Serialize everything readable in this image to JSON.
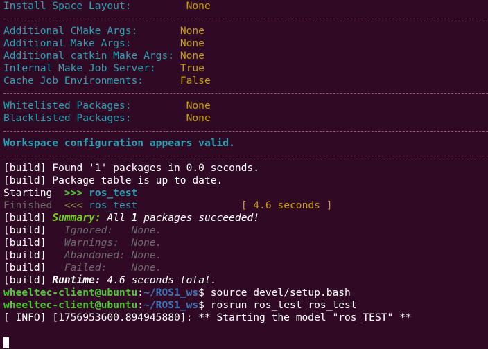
{
  "config": {
    "install_space_layout": {
      "key": "Install Space Layout:",
      "value": "None"
    },
    "additional_cmake_args": {
      "key": "Additional CMake Args:",
      "value": "None"
    },
    "additional_make_args": {
      "key": "Additional Make Args:",
      "value": "None"
    },
    "additional_catkin_make_args": {
      "key": "Additional catkin Make Args:",
      "value": "None"
    },
    "internal_make_job_server": {
      "key": "Internal Make Job Server:",
      "value": "True"
    },
    "cache_job_environments": {
      "key": "Cache Job Environments:",
      "value": "False"
    },
    "whitelisted_packages": {
      "key": "Whitelisted Packages:",
      "value": "None"
    },
    "blacklisted_packages": {
      "key": "Blacklisted Packages:",
      "value": "None"
    },
    "valid_message": "Workspace configuration appears valid."
  },
  "build": {
    "prefix": "[build]",
    "found": " Found '1' packages in 0.0 seconds.",
    "table": " Package table is up to date.",
    "starting_label": "Starting",
    "starting_arrow": ">>>",
    "starting_pkg": "ros_test",
    "finished_label": "Finished",
    "finished_arrow": "<<<",
    "finished_pkg": "ros_test",
    "finished_time": "[ 4.6 seconds ]",
    "summary_label": "Summary:",
    "summary_pre": " All ",
    "summary_count": "1",
    "summary_post": " packages succeeded!",
    "ignored_label": "Ignored:",
    "ignored_value": "None.",
    "warnings_label": "Warnings:",
    "warnings_value": "None.",
    "abandoned_label": "Abandoned:",
    "abandoned_value": "None.",
    "failed_label": "Failed:",
    "failed_value": "None.",
    "runtime_label": "Runtime:",
    "runtime_value": " 4.6 seconds total."
  },
  "prompts": [
    {
      "user": "wheeltec-client@ubuntu",
      "sep": ":",
      "path": "~/ROS1_ws",
      "symbol": "$",
      "command": " source devel/setup.bash"
    },
    {
      "user": "wheeltec-client@ubuntu",
      "sep": ":",
      "path": "~/ROS1_ws",
      "symbol": "$",
      "command": " rosrun ros_test ros_test"
    }
  ],
  "info_line": "[ INFO] [1756953600.894945880]: ** Starting the model \"ros_TEST\" **",
  "colors": {
    "background": "#300a24",
    "cyan": "#2aa1b3",
    "yellow": "#c4a000",
    "green": "#4ec932",
    "blue": "#3f73b8"
  }
}
